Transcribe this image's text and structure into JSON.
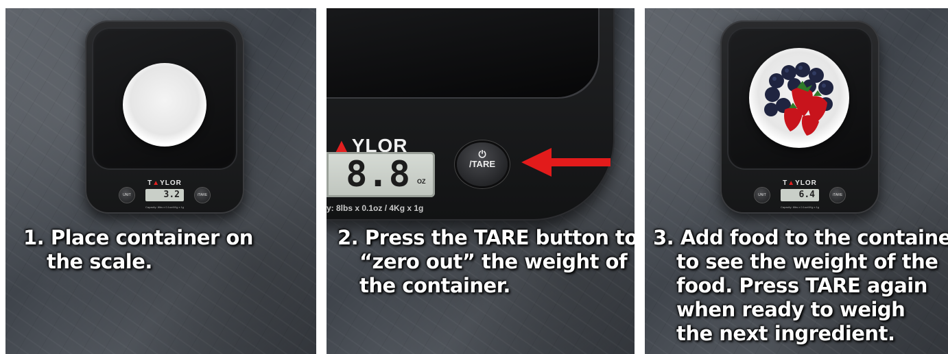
{
  "panels": [
    {
      "caption_number": "1.",
      "caption_lines": [
        "Place container on",
        "the scale."
      ],
      "scale": {
        "brand": "TAYLOR",
        "display": "3.2",
        "unit_button": "UNIT",
        "tare_button": "/TARE",
        "capacity": "Capacity: 8lbs x 0.1oz/4Kg x 1g"
      }
    },
    {
      "caption_number": "2.",
      "caption_lines": [
        "Press the TARE button to",
        "“zero out” the weight of",
        "the container."
      ],
      "scale": {
        "brand": "YLOR",
        "display": "8.8",
        "unit": "OZ",
        "spec": "y: 8lbs x 0.1oz / 4Kg x 1g",
        "tare_button": "/TARE"
      },
      "arrow_color": "#e21b1b"
    },
    {
      "caption_number": "3.",
      "caption_lines": [
        "Add food to the container",
        "to see the weight of the",
        "food. Press TARE again",
        "when ready to weigh",
        "the next ingredient."
      ],
      "scale": {
        "brand": "TAYLOR",
        "display": "6.4",
        "unit_button": "UNIT",
        "tare_button": "/TARE",
        "capacity": "Capacity: 8lbs x 0.1oz/4Kg x 1g"
      }
    }
  ]
}
